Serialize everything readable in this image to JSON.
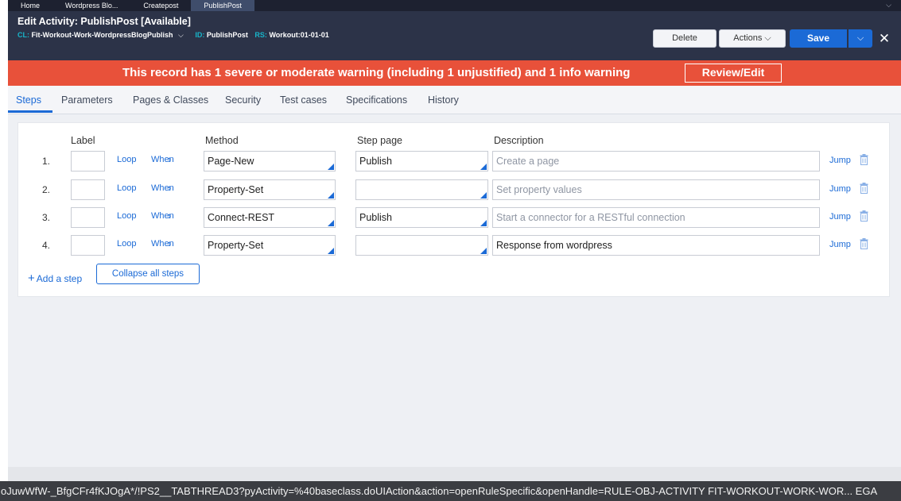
{
  "doc_tabs": [
    {
      "label": "Home"
    },
    {
      "label": "Wordpress Blo..."
    },
    {
      "label": "Createpost"
    },
    {
      "label": "PublishPost"
    }
  ],
  "header": {
    "title": "Edit Activity: PublishPost [Available]",
    "cl_key": "CL:",
    "cl_value": "Fit-Workout-Work-WordpressBlogPublish",
    "id_key": "ID:",
    "id_value": "PublishPost",
    "rs_key": "RS:",
    "rs_value": "Workout:01-01-01",
    "delete_label": "Delete",
    "actions_label": "Actions",
    "save_label": "Save"
  },
  "warning": {
    "text": "This record has 1 severe or moderate warning (including 1 unjustified) and 1 info warning",
    "button_label": "Review/Edit"
  },
  "rule_tabs": [
    {
      "label": "Steps"
    },
    {
      "label": "Parameters"
    },
    {
      "label": "Pages & Classes"
    },
    {
      "label": "Security"
    },
    {
      "label": "Test cases"
    },
    {
      "label": "Specifications"
    },
    {
      "label": "History"
    }
  ],
  "steps_table": {
    "headers": {
      "label": "Label",
      "method": "Method",
      "step_page": "Step page",
      "description": "Description"
    },
    "loop_label": "Loop",
    "when_label": "When",
    "jump_label": "Jump",
    "rows": [
      {
        "num": "1.",
        "method": "Page-New",
        "step_page": "Publish",
        "description": "Create a page",
        "description_is_placeholder": true
      },
      {
        "num": "2.",
        "method": "Property-Set",
        "step_page": "",
        "description": "Set property values",
        "description_is_placeholder": true
      },
      {
        "num": "3.",
        "method": "Connect-REST",
        "step_page": "Publish",
        "description": "Start a connector for a RESTful connection",
        "description_is_placeholder": true
      },
      {
        "num": "4.",
        "method": "Property-Set",
        "step_page": "",
        "description": "Response from wordpress",
        "description_is_placeholder": false
      }
    ],
    "add_step_label": "Add a step",
    "collapse_label": "Collapse all steps"
  },
  "status_bar": {
    "url": "oJuwWfW-_BfgCFr4fKJOgA*/!PS2__TABTHREAD3?pyActivity=%40baseclass.doUIAction&action=openRuleSpecific&openHandle=RULE-OBJ-ACTIVITY FIT-WORKOUT-WORK-WOR... EGA"
  },
  "colors": {
    "header_bg": "#2c3348",
    "warning_bg": "#e8513a",
    "accent": "#1b6ad6",
    "meta_key": "#18b5c9"
  }
}
